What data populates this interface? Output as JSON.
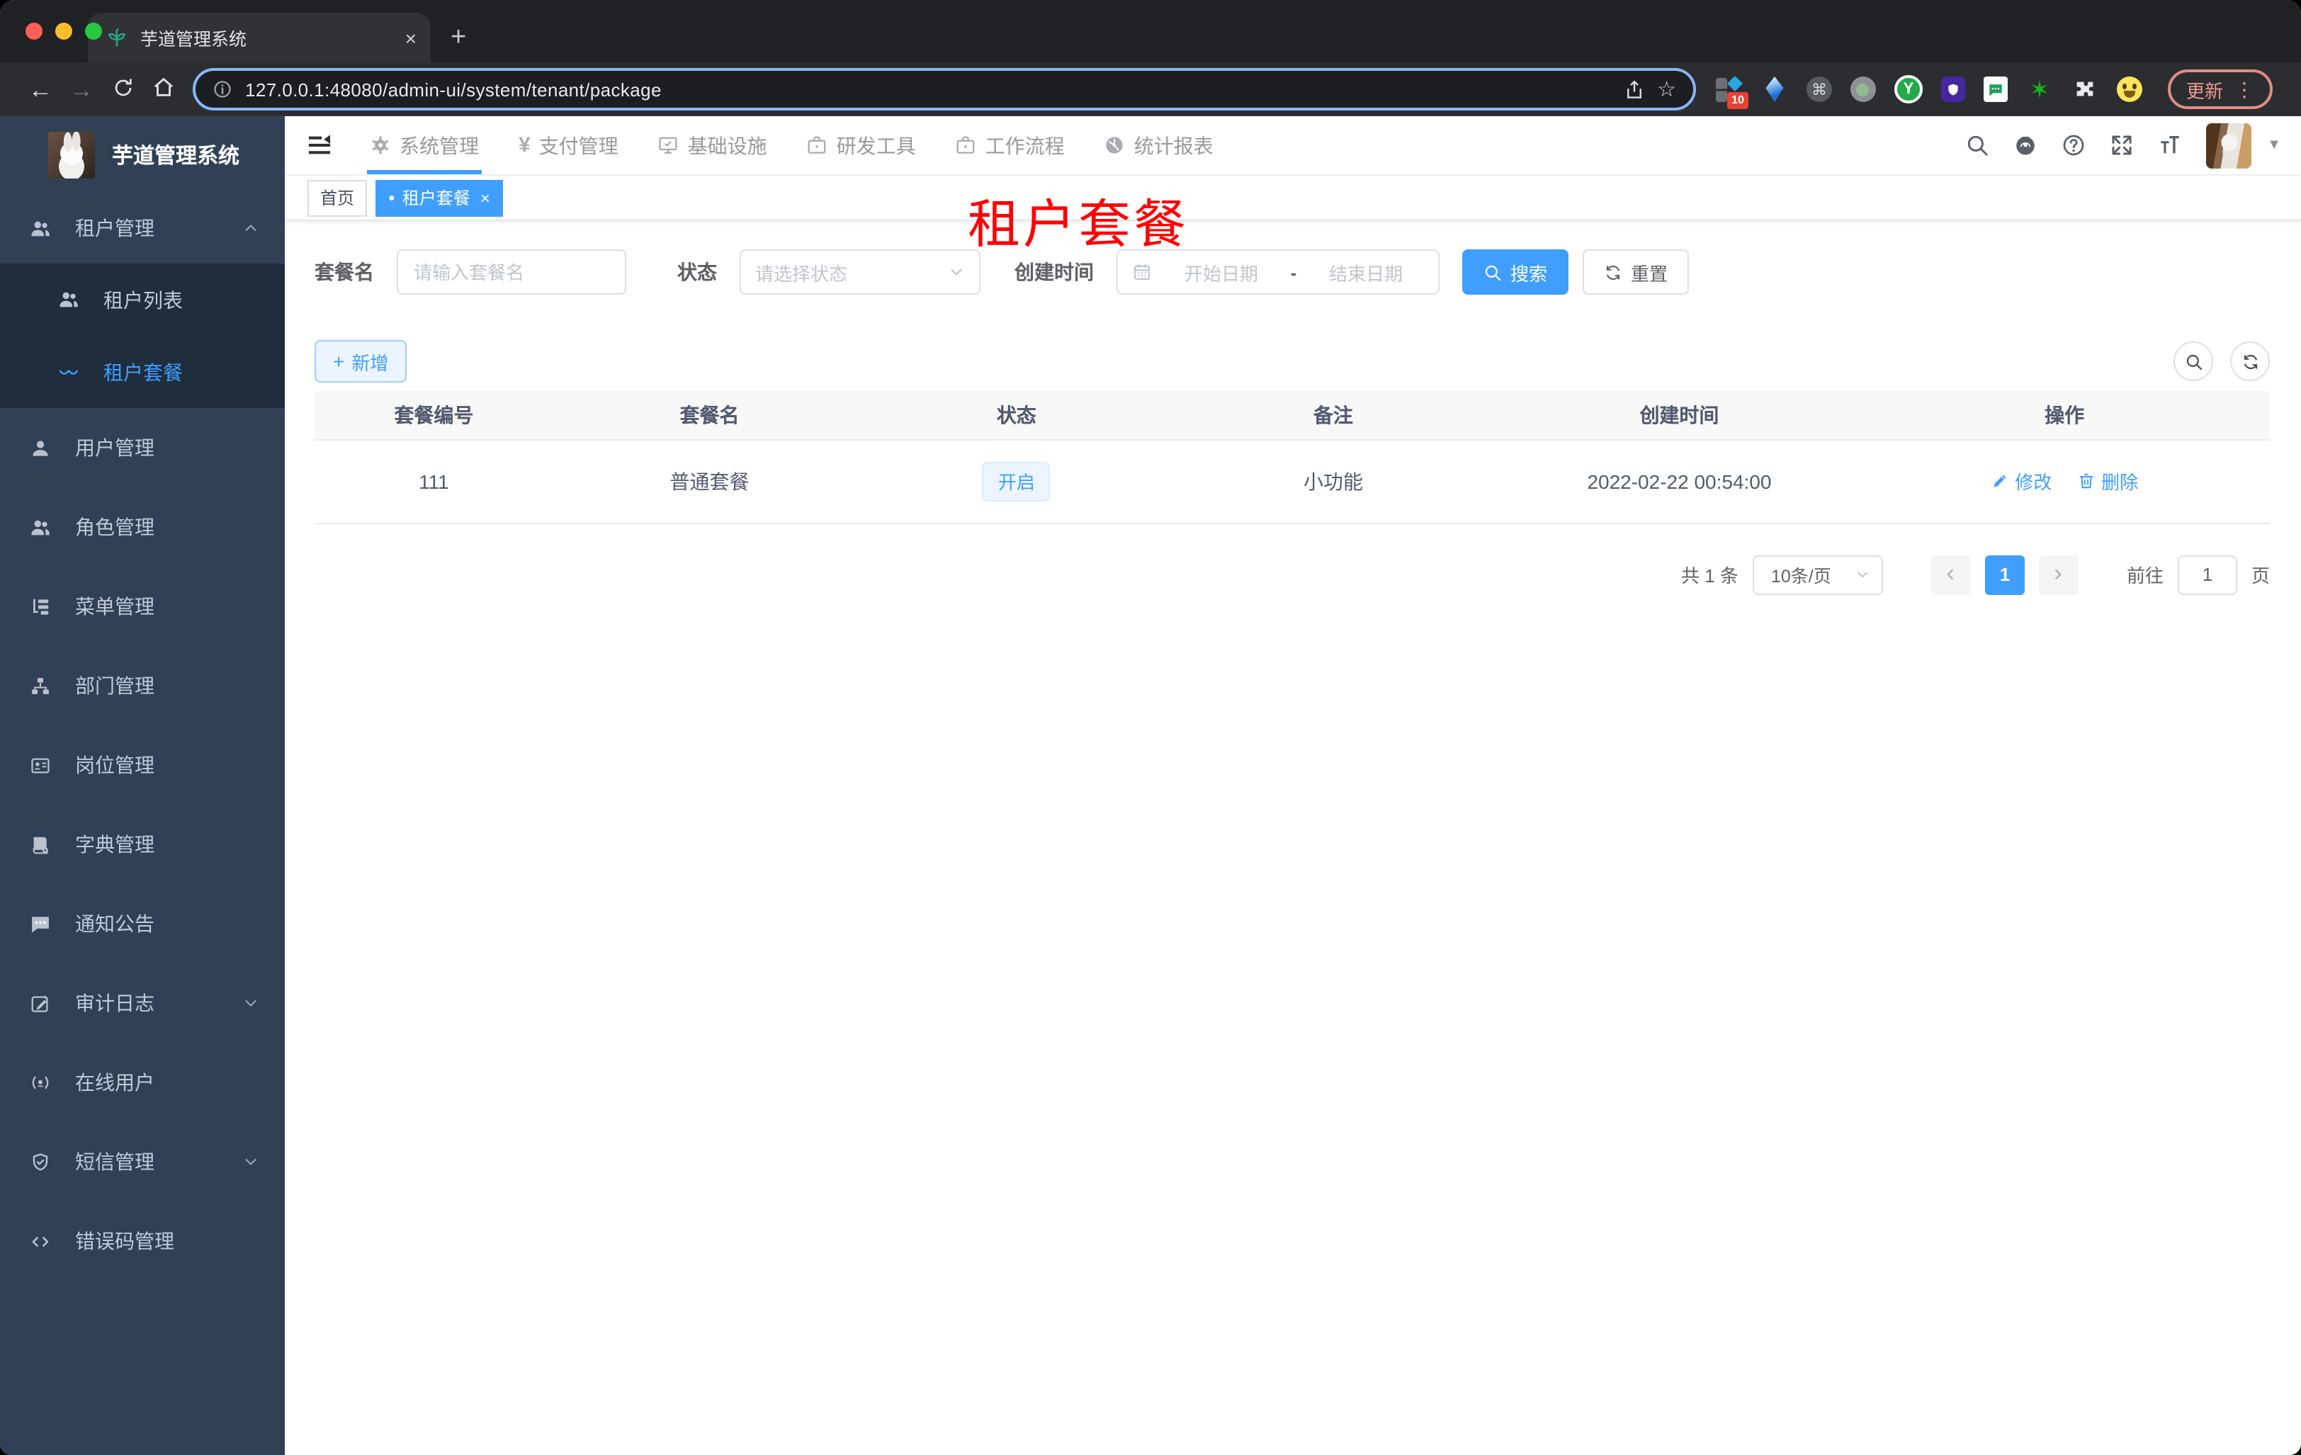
{
  "browser": {
    "tab_title": "芋道管理系统",
    "url": "127.0.0.1:48080/admin-ui/system/tenant/package",
    "extension_badge": "10",
    "update_label": "更新"
  },
  "icons": {
    "back": "←",
    "forward": "→",
    "star": "☆",
    "more": "⋮",
    "new_tab": "+",
    "caret": "▼",
    "tag_dot": "●",
    "tag_close": "×",
    "tab_close": "×",
    "yen": "¥",
    "cmd": "⌘",
    "ext_y": "Y",
    "ext_star": "✶",
    "plus": "+"
  },
  "app": {
    "logo_title": "芋道管理系统",
    "top_nav": [
      {
        "label": "系统管理"
      },
      {
        "label": "支付管理"
      },
      {
        "label": "基础设施"
      },
      {
        "label": "研发工具"
      },
      {
        "label": "工作流程"
      },
      {
        "label": "统计报表"
      }
    ],
    "sidebar": [
      {
        "label": "租户管理"
      },
      {
        "label": "租户列表"
      },
      {
        "label": "租户套餐"
      },
      {
        "label": "用户管理"
      },
      {
        "label": "角色管理"
      },
      {
        "label": "菜单管理"
      },
      {
        "label": "部门管理"
      },
      {
        "label": "岗位管理"
      },
      {
        "label": "字典管理"
      },
      {
        "label": "通知公告"
      },
      {
        "label": "审计日志"
      },
      {
        "label": "在线用户"
      },
      {
        "label": "短信管理"
      },
      {
        "label": "错误码管理"
      }
    ],
    "tags": {
      "home": "首页",
      "active": "租户套餐"
    },
    "watermark": "租户套餐",
    "search": {
      "name_label": "套餐名",
      "name_placeholder": "请输入套餐名",
      "status_label": "状态",
      "status_placeholder": "请选择状态",
      "date_label": "创建时间",
      "date_start": "开始日期",
      "date_sep": "-",
      "date_end": "结束日期",
      "submit": "搜索",
      "reset": "重置"
    },
    "toolbar": {
      "add": "新增"
    },
    "table": {
      "headers": [
        "套餐编号",
        "套餐名",
        "状态",
        "备注",
        "创建时间",
        "操作"
      ],
      "row": {
        "id": "111",
        "name": "普通套餐",
        "status": "开启",
        "remark": "小功能",
        "created_at": "2022-02-22 00:54:00",
        "edit": "修改",
        "remove": "删除"
      }
    },
    "pagination": {
      "total": "共 1 条",
      "size": "10条/页",
      "page": "1",
      "goto": "前往",
      "goto_value": "1",
      "unit": "页"
    }
  },
  "colors": {
    "primary": "#409eff",
    "sidebar_bg": "#304156",
    "submenu_bg": "#1f2d3d",
    "watermark": "#ff0000",
    "status_tag_bg": "#ecf5ff"
  }
}
